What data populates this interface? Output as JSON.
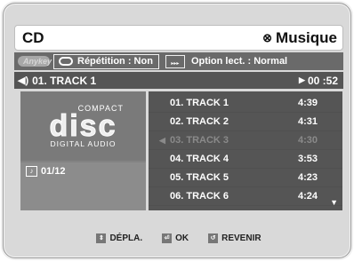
{
  "header": {
    "title": "CD",
    "source_icon": "disc-icon",
    "source_label": "Musique"
  },
  "options": {
    "anykey_label": "Anykey",
    "repeat_label": "Répétition : Non",
    "play_option_label": "Option lect. : Normal"
  },
  "now_playing": {
    "track": "01. TRACK 1",
    "time": "00 :52"
  },
  "disc": {
    "compact": "COMPACT",
    "disc": "disc",
    "digital_audio": "DIGITAL AUDIO"
  },
  "counter": {
    "value": "01/12"
  },
  "tracks": [
    {
      "name": "01. TRACK 1",
      "time": "4:39"
    },
    {
      "name": "02. TRACK 2",
      "time": "4:31"
    },
    {
      "name": "03. TRACK 3",
      "time": "4:30"
    },
    {
      "name": "04. TRACK 4",
      "time": "3:53"
    },
    {
      "name": "05. TRACK 5",
      "time": "4:23"
    },
    {
      "name": "06. TRACK 6",
      "time": "4:24"
    }
  ],
  "footer": {
    "move": "DÉPLA.",
    "ok": "OK",
    "back": "REVENIR"
  },
  "colors": {
    "panel_dark": "#555555",
    "panel_mid": "#838383",
    "frame": "#d9d9d9"
  }
}
